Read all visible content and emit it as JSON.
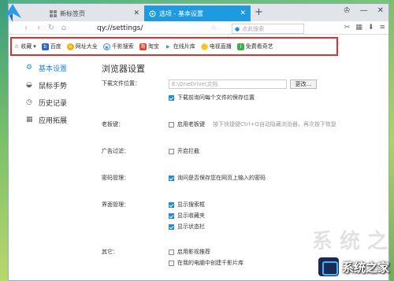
{
  "tabs": {
    "inactive_title": "新标签页",
    "active_title": "选项 - 基本设置",
    "new_tab": "+"
  },
  "window_controls": {
    "skin": "♔",
    "minimize": "—",
    "close": "✕"
  },
  "address": {
    "url": "qy://settings/",
    "search_placeholder": "点此搜索"
  },
  "bookmarks": {
    "favorites_label": "收藏",
    "items": [
      "百度",
      "网址大全",
      "千影搜索",
      "淘宝",
      "在线片库",
      "电视直播",
      "免费看奇艺"
    ]
  },
  "sidebar": {
    "items": [
      {
        "label": "基本设置",
        "active": true
      },
      {
        "label": "鼠标手势",
        "active": false
      },
      {
        "label": "历史记录",
        "active": false
      },
      {
        "label": "应用拓展",
        "active": false
      }
    ]
  },
  "settings": {
    "title": "浏览器设置",
    "download_label": "下载文件位置：",
    "download_path": "E:\\OneDrive\\文档",
    "change_button": "更改...",
    "ask_each_time": "下载前询问每个文件的保存位置",
    "boss_key_label": "老板键：",
    "boss_key_option": "启用老板键",
    "boss_key_hint": "按下快捷键Ctrl+Q自动隐藏浏览器，再次按下恢复",
    "ad_filter_label": "广告过滤：",
    "ad_filter_option": "开启拦截",
    "password_label": "密码管理：",
    "password_option": "询问是否保存您在网页上输入的密码",
    "ui_label": "界面管理：",
    "ui_options": [
      "显示搜索框",
      "显示收藏夹",
      "显示状态栏"
    ],
    "other_label": "其它：",
    "other_options": [
      "启用影视推荐",
      "在我的电脑中创建千影片库"
    ]
  },
  "watermark": {
    "text": "系统之家",
    "ghost": "系 统 之"
  },
  "colors": {
    "accent": "#1e88e5",
    "tab_active": "#1e9be0",
    "highlight_border": "#e0302c"
  }
}
